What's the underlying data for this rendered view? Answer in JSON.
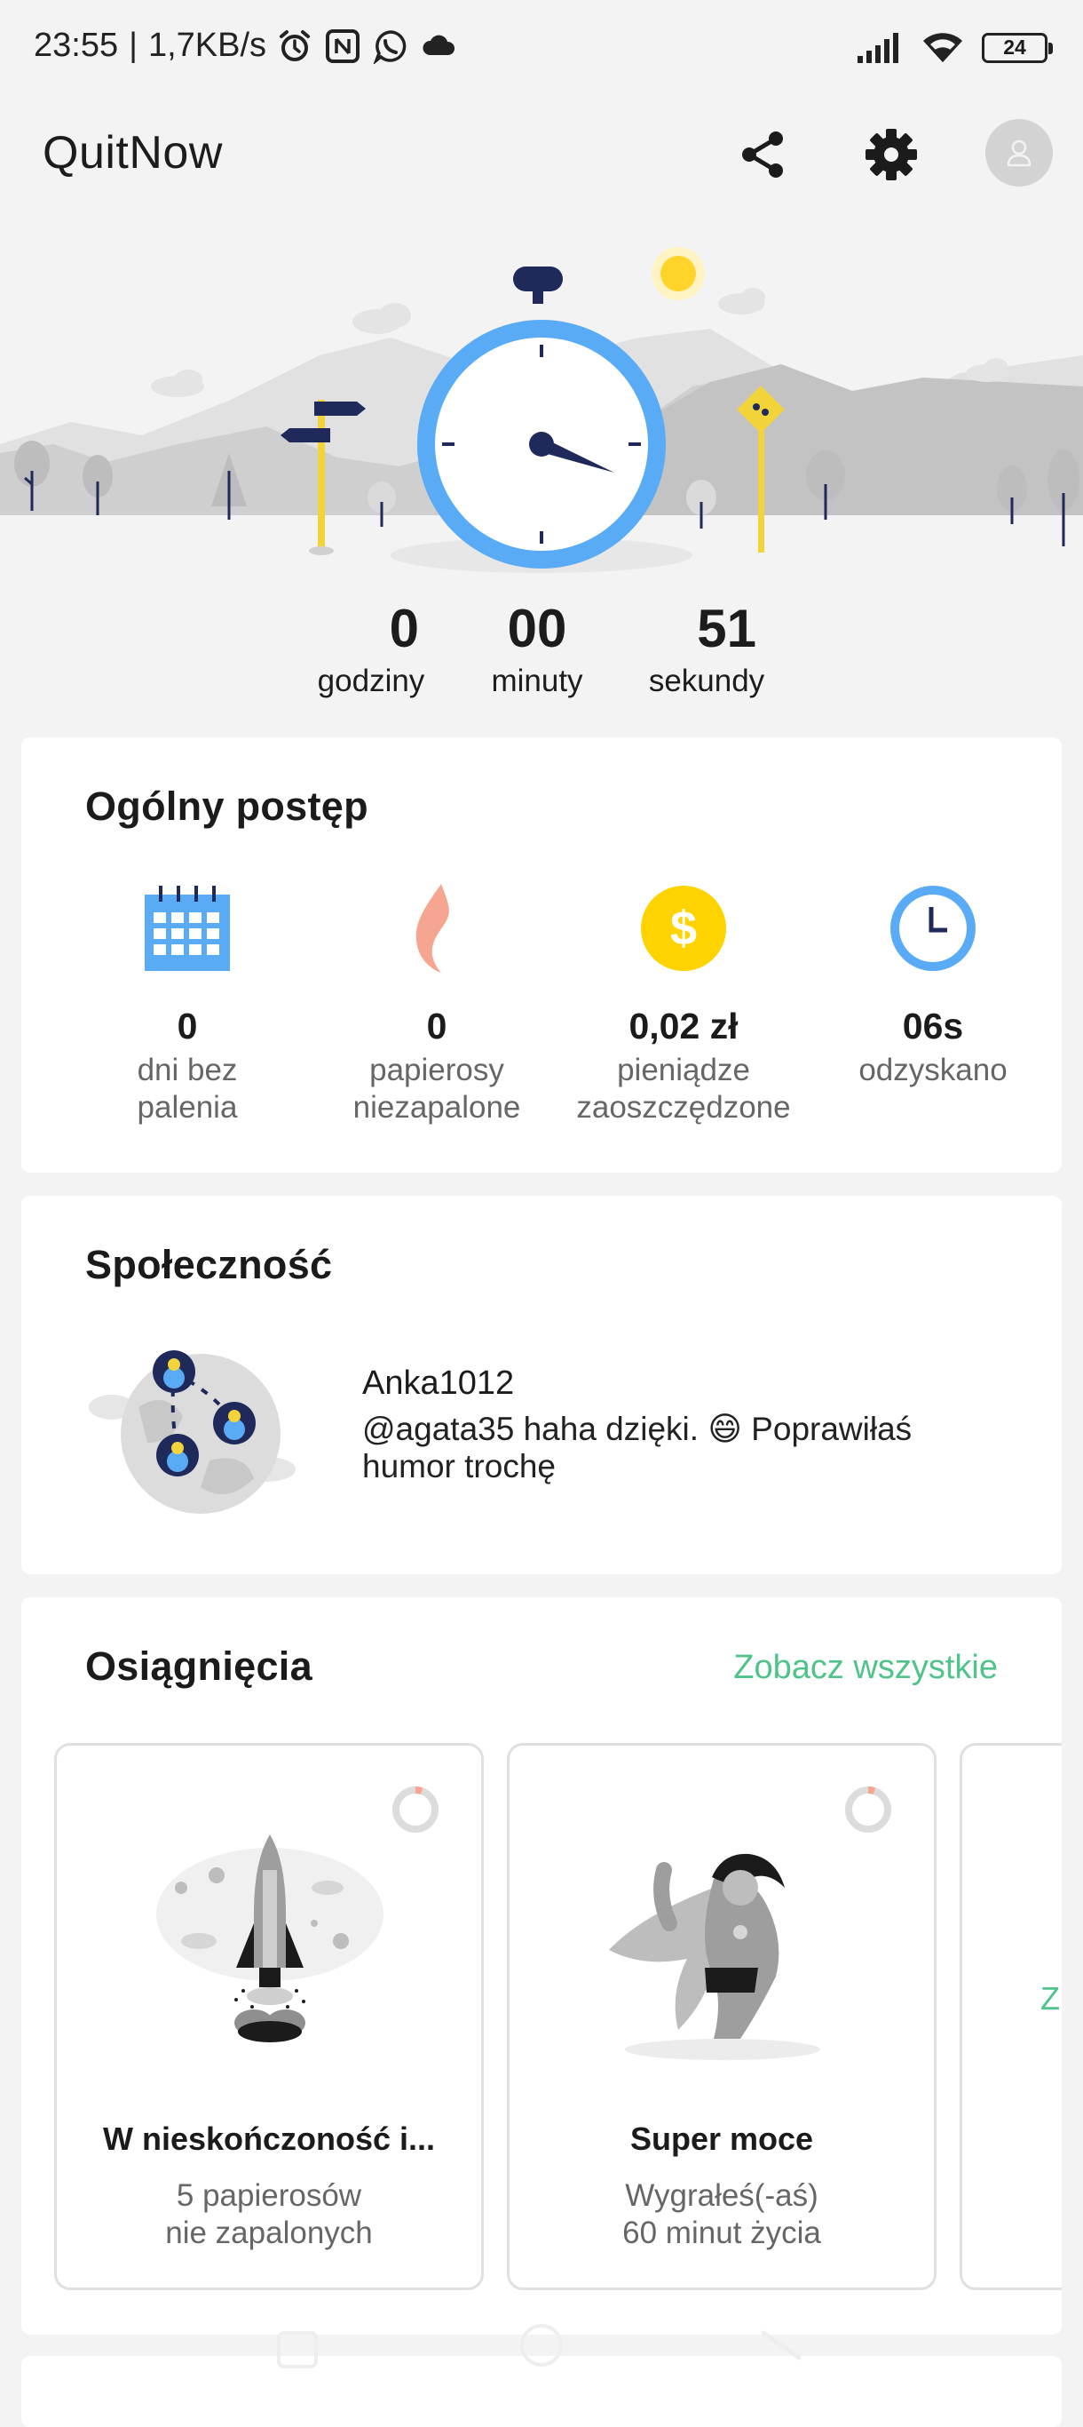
{
  "status_bar": {
    "time": "23:55",
    "separator": "|",
    "speed": "1,7KB/s",
    "icons": [
      "alarm-icon",
      "nfc-icon",
      "whatsapp-icon",
      "cloud-icon"
    ],
    "right_icons": [
      "signal-icon",
      "wifi-icon"
    ],
    "battery": "24"
  },
  "app_bar": {
    "title": "QuitNow",
    "actions": [
      "share-icon",
      "settings-icon",
      "avatar-icon"
    ]
  },
  "timer": {
    "hours": "0",
    "hours_label": "godziny",
    "minutes": "00",
    "minutes_label": "minuty",
    "seconds": "51",
    "seconds_label": "sekundy"
  },
  "progress": {
    "title": "Ogólny postęp",
    "stats": [
      {
        "icon": "calendar-icon",
        "value": "0",
        "label_1": "dni bez",
        "label_2": "palenia"
      },
      {
        "icon": "flame-icon",
        "value": "0",
        "label_1": "papierosy",
        "label_2": "niezapalone"
      },
      {
        "icon": "coin-icon",
        "value": "0,02 zł",
        "label_1": "pieniądze",
        "label_2": "zaoszczędzone"
      },
      {
        "icon": "clock-icon",
        "value": "06s",
        "label_1": "odzyskano",
        "label_2": ""
      }
    ]
  },
  "community": {
    "title": "Społeczność",
    "user": "Anka1012",
    "message": "@agata35 haha dzięki. 😄 Poprawiłaś humor trochę"
  },
  "achievements": {
    "title": "Osiągnięcia",
    "see_all": "Zobacz wszystkie",
    "items": [
      {
        "title": "W nieskończoność i...",
        "desc_1": "5 papierosów",
        "desc_2": "nie zapalonych",
        "progress": 0.05
      },
      {
        "title": "Super moce",
        "desc_1": "Wygrałeś(-aś)",
        "desc_2": "60 minut życia",
        "progress": 0.05
      }
    ],
    "peek_letter": "Z"
  },
  "colors": {
    "accent_green": "#4fc389",
    "clock_blue": "#5aabf5",
    "navy": "#1f2a5a",
    "sign_yellow": "#f2d33a",
    "coin_yellow": "#ffd300",
    "flame": "#f5a590"
  }
}
